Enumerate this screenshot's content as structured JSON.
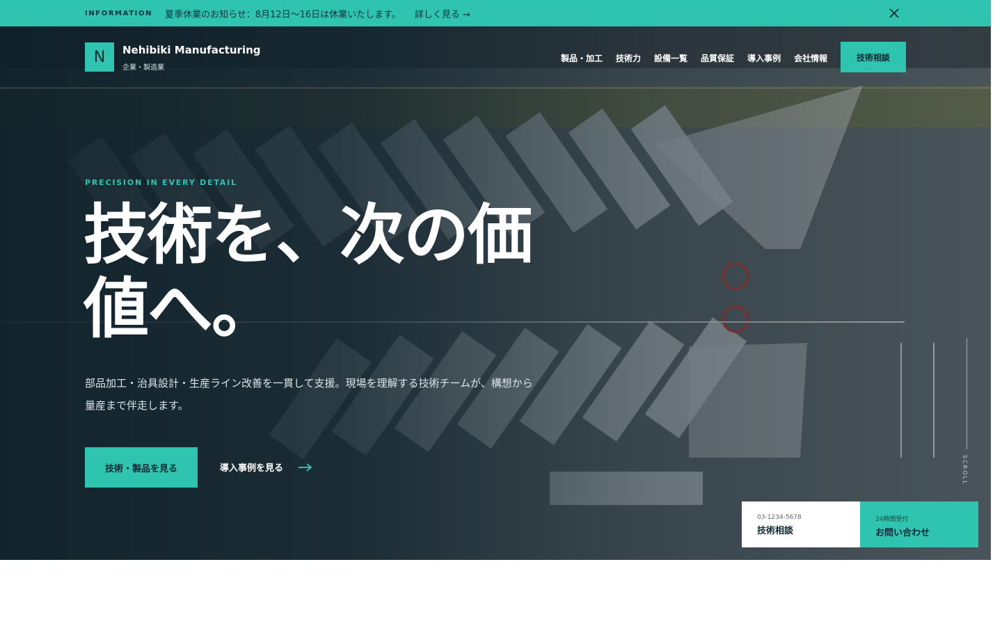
{
  "info_bar": {
    "label": "INFORMATION",
    "text": "夏季休業のお知らせ：8月12日〜16日は休業いたします。",
    "link": "詳しく見る →"
  },
  "header": {
    "logo_letter": "N",
    "brand_name": "Nehibiki Manufacturing",
    "brand_sub": "企業・製造業",
    "nav": [
      "製品・加工",
      "技術力",
      "設備一覧",
      "品質保証",
      "導入事例",
      "会社情報"
    ],
    "cta": "技術相談"
  },
  "hero": {
    "eyebrow": "PRECISION IN EVERY DETAIL",
    "title_line1": "技術を、次の価",
    "title_line2": "値へ。",
    "description": "部品加工・治具設計・生産ライン改善を一貫して支援。現場を理解する技術チームが、構想から量産まで伴走します。",
    "primary_button": "技術・製品を見る",
    "secondary_button": "導入事例を見る",
    "scroll": "SCROLL"
  },
  "contact": {
    "phone_small": "03-1234-5678",
    "phone_label": "技術相談",
    "form_small": "24時間受付",
    "form_label": "お問い合わせ"
  },
  "colors": {
    "accent": "#2ec4b0",
    "dark": "#0f2a33"
  }
}
